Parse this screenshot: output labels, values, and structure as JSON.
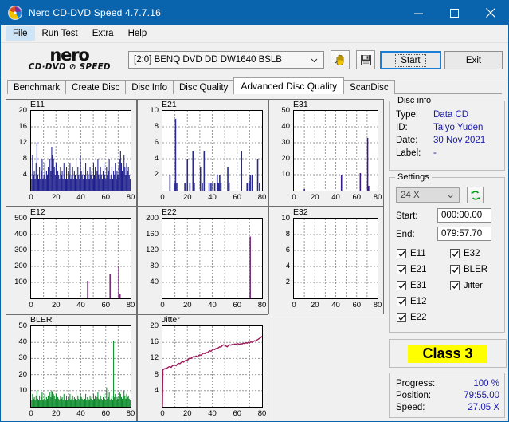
{
  "window": {
    "title": "Nero CD-DVD Speed 4.7.7.16",
    "icon": "disc-icon",
    "minimize": "minimize-icon",
    "maximize": "maximize-icon",
    "close": "close-icon",
    "accent": "#0a64ad"
  },
  "menu": {
    "items": [
      {
        "label": "File",
        "mnemonic": "F",
        "active": true
      },
      {
        "label": "Run Test",
        "mnemonic": "R",
        "active": false
      },
      {
        "label": "Extra",
        "mnemonic": "E",
        "active": false
      },
      {
        "label": "Help",
        "mnemonic": "H",
        "active": false
      }
    ]
  },
  "toolbar": {
    "logo_main": "nero",
    "logo_sub": "CD·DVD ⊘ SPEED",
    "drive": "[2:0]   BENQ DVD DD DW1640 BSLB",
    "drive_caret": "chevron-down-icon",
    "eject_icon": "eject-hand-icon",
    "save_icon": "floppy-save-icon",
    "start_label": "Start",
    "start_mnemonic": "S",
    "exit_label": "Exit",
    "exit_mnemonic": "x"
  },
  "tabs": [
    {
      "label": "Benchmark",
      "active": false
    },
    {
      "label": "Create Disc",
      "active": false
    },
    {
      "label": "Disc Info",
      "active": false
    },
    {
      "label": "Disc Quality",
      "active": false
    },
    {
      "label": "Advanced Disc Quality",
      "active": true
    },
    {
      "label": "ScanDisc",
      "active": false
    }
  ],
  "disc_info": {
    "legend": "Disc info",
    "rows": [
      {
        "key": "Type:",
        "value": "Data CD"
      },
      {
        "key": "ID:",
        "value": "Taiyo Yuden"
      },
      {
        "key": "Date:",
        "value": "30 Nov 2021"
      },
      {
        "key": "Label:",
        "value": "-"
      }
    ]
  },
  "settings": {
    "legend": "Settings",
    "speed": "24 X",
    "speed_caret": "chevron-down-icon",
    "refresh_icon": "refresh-icon",
    "start_label": "Start:",
    "start_value": "000:00.00",
    "end_label": "End:",
    "end_value": "079:57.70",
    "checkboxes_left": [
      {
        "label": "E11",
        "checked": true
      },
      {
        "label": "E21",
        "checked": true
      },
      {
        "label": "E31",
        "checked": true
      },
      {
        "label": "E12",
        "checked": true
      },
      {
        "label": "E22",
        "checked": true
      }
    ],
    "checkboxes_right": [
      {
        "label": "E32",
        "checked": true
      },
      {
        "label": "BLER",
        "checked": true
      },
      {
        "label": "Jitter",
        "checked": true
      }
    ]
  },
  "quality": {
    "class_label": "Class 3",
    "class_bg": "#ffff00"
  },
  "status": {
    "rows": [
      {
        "key": "Progress:",
        "value": "100 %"
      },
      {
        "key": "Position:",
        "value": "79:55.00"
      },
      {
        "key": "Speed:",
        "value": "27.05 X"
      }
    ]
  },
  "chart_data": [
    {
      "type": "bar",
      "title": "E11",
      "color": "#1c1c8c",
      "xlabel": "",
      "ylabel": "",
      "xlim": [
        0,
        80
      ],
      "ylim": [
        0,
        20
      ],
      "xticks": [
        0,
        20,
        40,
        60,
        80
      ],
      "yticks": [
        4,
        8,
        12,
        16,
        20
      ],
      "grid": true,
      "x": [
        0.5,
        1.2,
        1.9,
        2.6,
        3.3,
        4,
        4.7,
        5.4,
        6.1,
        6.8,
        7.5,
        8.2,
        8.9,
        9.6,
        10.3,
        11,
        11.7,
        12.4,
        13.1,
        13.8,
        14.5,
        15.2,
        15.9,
        16.6,
        17.3,
        18,
        18.7,
        19.4,
        20.1,
        20.8,
        21.5,
        22.2,
        22.9,
        23.6,
        24.3,
        25,
        25.7,
        26.4,
        27.1,
        27.8,
        28.5,
        29.2,
        29.9,
        30.6,
        31.3,
        32,
        32.7,
        33.4,
        34.1,
        34.8,
        35.5,
        36.2,
        36.9,
        37.6,
        38.3,
        39,
        39.7,
        40.4,
        41.1,
        41.8,
        42.5,
        43.2,
        43.9,
        44.6,
        45.3,
        46,
        46.7,
        47.4,
        48.1,
        48.8,
        49.5,
        50.2,
        50.9,
        51.6,
        52.3,
        53,
        53.7,
        54.4,
        55.1,
        55.8,
        56.5,
        57.2,
        57.9,
        58.6,
        59.3,
        60,
        60.7,
        61.4,
        62.1,
        62.8,
        63.5,
        64.2,
        64.9,
        65.6,
        66.3,
        67,
        67.7,
        68.4,
        69.1,
        69.8,
        70.5,
        71.2,
        71.9,
        72.6,
        73.3,
        74,
        74.7,
        75.4,
        76.1,
        76.8,
        77.5,
        78.2,
        78.9,
        79.6
      ],
      "values": [
        3,
        9,
        4,
        5,
        3,
        7,
        12,
        4,
        3,
        6,
        3,
        5,
        8,
        3,
        4,
        7,
        3,
        5,
        4,
        6,
        3,
        8,
        5,
        11,
        9,
        8,
        6,
        4,
        7,
        3,
        5,
        4,
        3,
        6,
        4,
        5,
        3,
        7,
        4,
        3,
        6,
        3,
        5,
        4,
        7,
        3,
        4,
        6,
        3,
        5,
        4,
        8,
        3,
        6,
        4,
        3,
        9,
        5,
        4,
        3,
        6,
        4,
        7,
        3,
        5,
        4,
        3,
        6,
        4,
        5,
        3,
        7,
        4,
        6,
        3,
        5,
        8,
        4,
        3,
        6,
        4,
        3,
        5,
        7,
        4,
        3,
        6,
        4,
        5,
        8,
        3,
        4,
        6,
        3,
        5,
        4,
        7,
        3,
        5,
        4,
        6,
        8,
        10,
        7,
        5,
        6,
        9,
        6,
        4,
        7,
        5,
        6,
        4,
        3
      ]
    },
    {
      "type": "bar",
      "title": "E21",
      "color": "#2a2a8c",
      "xlim": [
        0,
        80
      ],
      "ylim": [
        0,
        10
      ],
      "xticks": [
        0,
        20,
        40,
        60,
        80
      ],
      "yticks": [
        2,
        4,
        6,
        8,
        10
      ],
      "grid": true,
      "x": [
        6,
        9.5,
        10.5,
        11.5,
        18,
        20,
        22,
        24.5,
        25.5,
        30.5,
        32,
        33.5,
        37.5,
        39,
        40.5,
        42,
        44,
        45,
        46,
        47,
        52.5,
        53.5,
        63.5,
        68,
        69.5,
        70.5,
        72,
        76.5,
        78
      ],
      "values": [
        2,
        1,
        9,
        1,
        1,
        4,
        1,
        5,
        1,
        3,
        1,
        5,
        1,
        1,
        1,
        1,
        2,
        1,
        2,
        1,
        3,
        1,
        5,
        1,
        1,
        2,
        2,
        4,
        1
      ]
    },
    {
      "type": "bar",
      "title": "E31",
      "color": "#3a1a8c",
      "xlim": [
        0,
        80
      ],
      "ylim": [
        0,
        50
      ],
      "xticks": [
        0,
        20,
        40,
        60,
        80
      ],
      "yticks": [
        10,
        20,
        30,
        40,
        50
      ],
      "grid": true,
      "x": [
        10,
        45.5,
        63.5,
        70.5,
        71.5
      ],
      "values": [
        1,
        10,
        11,
        33,
        3
      ]
    },
    {
      "type": "bar",
      "title": "E12",
      "color": "#7a2a7a",
      "xlim": [
        0,
        80
      ],
      "ylim": [
        0,
        500
      ],
      "xticks": [
        0,
        20,
        40,
        60,
        80
      ],
      "yticks": [
        100,
        200,
        300,
        400,
        500
      ],
      "grid": true,
      "x": [
        45.5,
        63.5,
        70.5,
        71.5
      ],
      "values": [
        110,
        150,
        200,
        30
      ]
    },
    {
      "type": "bar",
      "title": "E22",
      "color": "#7a2a7a",
      "xlim": [
        0,
        80
      ],
      "ylim": [
        0,
        200
      ],
      "xticks": [
        0,
        20,
        40,
        60,
        80
      ],
      "yticks": [
        40,
        80,
        120,
        160,
        200
      ],
      "grid": true,
      "x": [
        70.5
      ],
      "values": [
        155
      ]
    },
    {
      "type": "bar",
      "title": "E32",
      "color": "#7a2a7a",
      "xlim": [
        0,
        80
      ],
      "ylim": [
        0,
        10
      ],
      "xticks": [
        0,
        20,
        40,
        60,
        80
      ],
      "yticks": [
        2,
        4,
        6,
        8,
        10
      ],
      "grid": true,
      "x": [],
      "values": []
    },
    {
      "type": "bar",
      "title": "BLER",
      "color": "#0a8a28",
      "xlim": [
        0,
        80
      ],
      "ylim": [
        0,
        50
      ],
      "xticks": [
        0,
        20,
        40,
        60,
        80
      ],
      "yticks": [
        10,
        20,
        30,
        40,
        50
      ],
      "grid": true,
      "x": [
        0.5,
        1.2,
        1.9,
        2.6,
        3.3,
        4,
        4.7,
        5.4,
        6.1,
        6.8,
        7.5,
        8.2,
        8.9,
        9.6,
        10.3,
        11,
        11.7,
        12.4,
        13.1,
        13.8,
        14.5,
        15.2,
        15.9,
        16.6,
        17.3,
        18,
        18.7,
        19.4,
        20.1,
        20.8,
        21.5,
        22.2,
        22.9,
        23.6,
        24.3,
        25,
        25.7,
        26.4,
        27.1,
        27.8,
        28.5,
        29.2,
        29.9,
        30.6,
        31.3,
        32,
        32.7,
        33.4,
        34.1,
        34.8,
        35.5,
        36.2,
        36.9,
        37.6,
        38.3,
        39,
        39.7,
        40.4,
        41.1,
        41.8,
        42.5,
        43.2,
        43.9,
        44.6,
        45.3,
        46,
        46.7,
        47.4,
        48.1,
        48.8,
        49.5,
        50.2,
        50.9,
        51.6,
        52.3,
        53,
        53.7,
        54.4,
        55.1,
        55.8,
        56.5,
        57.2,
        57.9,
        58.6,
        59.3,
        60,
        60.7,
        61.4,
        62.1,
        62.8,
        63.5,
        64.2,
        64.9,
        65.6,
        66.3,
        67,
        67.7,
        68.4,
        69.1,
        69.8,
        70.5,
        71.2,
        71.9,
        72.6,
        73.3,
        74,
        74.7,
        75.4,
        76.1,
        76.8,
        77.5,
        78.2,
        78.9,
        79.6
      ],
      "values": [
        4,
        8,
        5,
        6,
        4,
        7,
        10,
        5,
        4,
        7,
        4,
        6,
        9,
        4,
        5,
        8,
        4,
        6,
        5,
        7,
        4,
        9,
        6,
        10,
        9,
        8,
        7,
        5,
        8,
        4,
        6,
        5,
        4,
        7,
        5,
        6,
        4,
        8,
        5,
        4,
        7,
        4,
        6,
        5,
        8,
        4,
        5,
        7,
        4,
        6,
        5,
        9,
        4,
        7,
        5,
        4,
        8,
        6,
        5,
        4,
        7,
        5,
        8,
        4,
        6,
        5,
        4,
        7,
        5,
        6,
        4,
        8,
        5,
        7,
        4,
        6,
        9,
        5,
        4,
        7,
        5,
        4,
        6,
        8,
        5,
        4,
        12,
        5,
        6,
        9,
        4,
        5,
        7,
        4,
        41,
        6,
        8,
        4,
        6,
        5,
        7,
        9,
        8,
        6,
        5,
        7,
        10,
        7,
        5,
        8,
        6,
        7,
        5,
        4
      ]
    },
    {
      "type": "line",
      "title": "Jitter",
      "color": "#9b1b5a",
      "xlim": [
        0,
        80
      ],
      "ylim": [
        0,
        20
      ],
      "xticks": [
        0,
        20,
        40,
        60,
        80
      ],
      "yticks": [
        4,
        8,
        12,
        16,
        20
      ],
      "grid": true,
      "x": [
        0,
        0.3,
        1,
        2,
        3,
        4,
        5,
        6,
        7,
        8,
        9,
        10,
        11,
        12,
        13,
        14,
        15,
        16,
        17,
        18,
        19,
        20,
        21,
        22,
        23,
        24,
        25,
        26,
        27,
        28,
        29,
        30,
        31,
        32,
        33,
        34,
        35,
        36,
        37,
        38,
        39,
        40,
        41,
        42,
        43,
        44,
        45,
        46,
        47,
        48,
        49,
        50,
        51,
        52,
        53,
        54,
        55,
        56,
        57,
        58,
        59,
        60,
        61,
        62,
        63,
        64,
        65,
        66,
        67,
        68,
        69,
        70,
        71,
        72,
        73,
        74,
        75,
        76,
        77,
        78,
        79,
        80
      ],
      "values": [
        0,
        9.2,
        9.3,
        9.5,
        9.4,
        9.7,
        9.9,
        10.0,
        9.8,
        10.2,
        10.3,
        10.4,
        10.2,
        10.6,
        10.8,
        10.7,
        11.0,
        11.2,
        11.1,
        11.4,
        11.6,
        11.5,
        11.9,
        12.1,
        12.0,
        12.3,
        12.5,
        12.4,
        12.6,
        12.4,
        12.7,
        12.9,
        12.8,
        13.1,
        13.3,
        13.2,
        13.5,
        13.4,
        13.7,
        13.9,
        13.8,
        14.1,
        14.3,
        14.2,
        14.5,
        14.4,
        14.7,
        14.9,
        14.8,
        15.2,
        15.4,
        15.3,
        15.1,
        14.9,
        15.2,
        15.4,
        15.3,
        15.5,
        15.4,
        15.6,
        15.5,
        15.7,
        15.6,
        15.5,
        15.7,
        15.6,
        15.8,
        15.7,
        15.9,
        15.8,
        16.0,
        15.9,
        16.1,
        16.0,
        16.2,
        16.4,
        16.3,
        16.6,
        16.8,
        17.0,
        17.2,
        17.5
      ]
    }
  ]
}
